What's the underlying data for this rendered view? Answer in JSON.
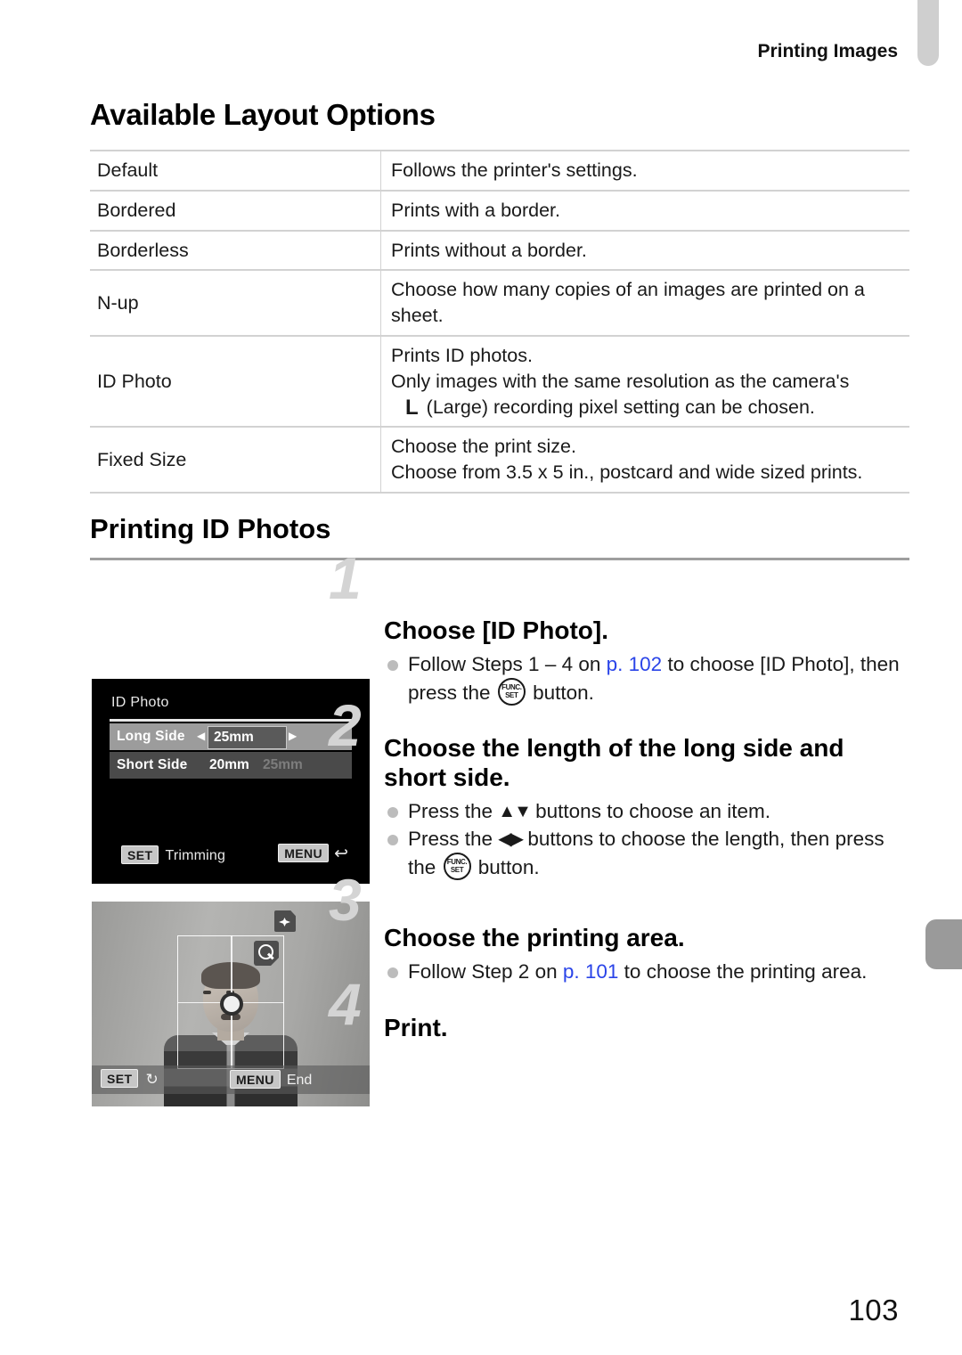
{
  "header": {
    "running_title": "Printing Images"
  },
  "section": {
    "title": "Available Layout Options",
    "table": {
      "rows": [
        {
          "name": "Default",
          "lines": [
            "Follows the printer's settings."
          ]
        },
        {
          "name": "Bordered",
          "lines": [
            "Prints with a border."
          ]
        },
        {
          "name": "Borderless",
          "lines": [
            "Prints without a border."
          ]
        },
        {
          "name": "N-up",
          "lines": [
            "Choose how many copies of an images are printed on a sheet."
          ]
        },
        {
          "name": "ID Photo",
          "lines": [
            "Prints ID photos.",
            "Only images with the same resolution as the camera's",
            "(Large) recording pixel setting can be chosen."
          ],
          "icon_label": "L"
        },
        {
          "name": "Fixed Size",
          "lines": [
            "Choose the print size.",
            "Choose from 3.5 x 5 in., postcard and wide sized prints."
          ]
        }
      ]
    }
  },
  "procedure": {
    "title": "Printing ID Photos",
    "steps": [
      {
        "number": "1",
        "heading": "Choose [ID Photo].",
        "bullets": [
          {
            "pre": "Follow Steps 1 – 4 on ",
            "link": "p. 102",
            "post": " to choose [ID Photo], then press the ",
            "button": "FUNC.SET",
            "tail": " button."
          }
        ]
      },
      {
        "number": "2",
        "heading": "Choose the length of the long side and short side.",
        "bullets": [
          {
            "pre": "Press the ",
            "glyph": "▲▼",
            "post": " buttons to choose an item."
          },
          {
            "pre": "Press the ",
            "glyph": "◀▶",
            "post": " buttons to choose the length, then press the ",
            "button": "FUNC.SET",
            "tail": " button."
          }
        ]
      },
      {
        "number": "3",
        "heading": "Choose the printing area.",
        "bullets": [
          {
            "pre": "Follow Step 2 on ",
            "link": "p. 101",
            "post": " to choose the printing area."
          }
        ]
      },
      {
        "number": "4",
        "heading": "Print.",
        "bullets": []
      }
    ]
  },
  "lcd_menu": {
    "title": "ID Photo",
    "rows": [
      {
        "label": "Long Side",
        "value": "25mm",
        "ghost": "",
        "selected": true
      },
      {
        "label": "Short Side",
        "value": "20mm",
        "ghost": "25mm",
        "selected": false
      }
    ],
    "footer_left_badge": "SET",
    "footer_left_text": "Trimming",
    "footer_right_badge": "MENU",
    "footer_right_glyph": "↩"
  },
  "lcd_trim": {
    "footer_left_badge": "SET",
    "footer_left_glyph": "↻",
    "footer_right_badge": "MENU",
    "footer_right_text": "End"
  },
  "footer": {
    "page_number": "103"
  },
  "buttons": {
    "func_top": "FUNC.",
    "func_bottom": "SET"
  }
}
